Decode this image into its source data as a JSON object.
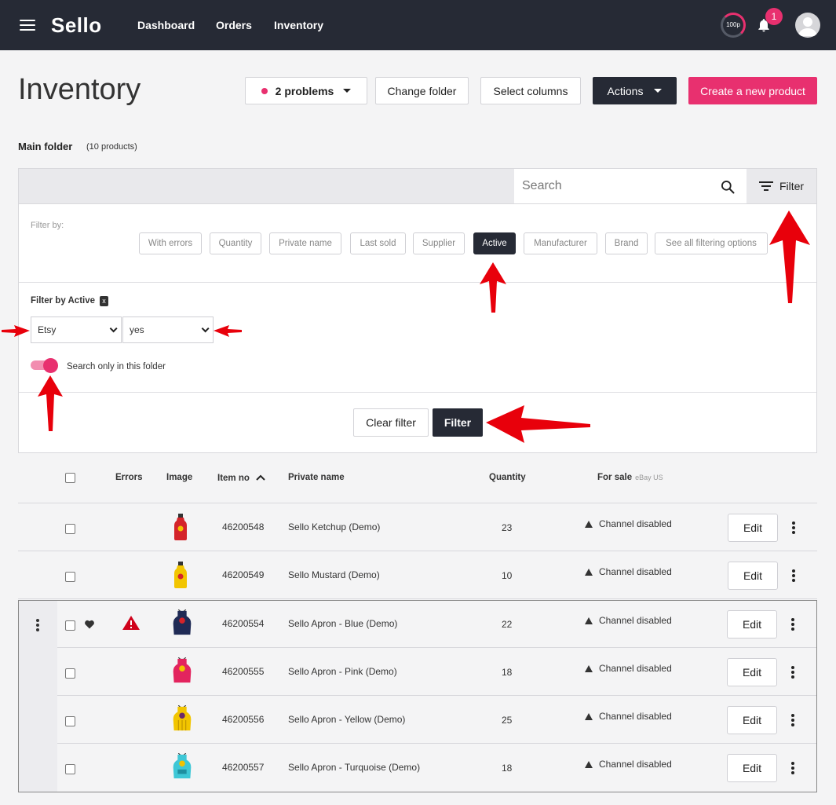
{
  "app": {
    "logo": "Sello",
    "nav": [
      "Dashboard",
      "Orders",
      "Inventory"
    ],
    "usage_label": "100p",
    "notification_count": "1"
  },
  "header": {
    "title": "Inventory",
    "problems_label": "2 problems",
    "change_folder_label": "Change folder",
    "select_columns_label": "Select columns",
    "actions_label": "Actions",
    "create_label": "Create a new product"
  },
  "folder": {
    "name": "Main folder",
    "count": "(10 products)"
  },
  "search": {
    "placeholder": "Search",
    "filter_label": "Filter"
  },
  "filter": {
    "filter_by_label": "Filter by:",
    "chips": [
      "With errors",
      "Quantity",
      "Private name",
      "Last sold",
      "Supplier",
      "Active",
      "Manufacturer",
      "Brand",
      "See all filtering options"
    ],
    "active_chip": "Active",
    "active_title": "Filter by Active",
    "remove_label": "x",
    "channel_value": "Etsy",
    "state_value": "yes",
    "toggle_label": "Search only in this folder",
    "toggle_on": true,
    "clear_label": "Clear filter",
    "apply_label": "Filter"
  },
  "table": {
    "headers": {
      "errors": "Errors",
      "image": "Image",
      "item_no": "Item no",
      "private_name": "Private name",
      "quantity": "Quantity",
      "for_sale": "For sale",
      "for_sale_sub": "eBay US"
    },
    "edit_label": "Edit",
    "rows": [
      {
        "item_no": "46200548",
        "name": "Sello Ketchup (Demo)",
        "quantity": "23",
        "status": "Channel disabled",
        "image": "ketchup-bottle"
      },
      {
        "item_no": "46200549",
        "name": "Sello Mustard (Demo)",
        "quantity": "10",
        "status": "Channel disabled",
        "image": "mustard-bottle"
      },
      {
        "item_no": "46200554",
        "name": "Sello Apron - Blue (Demo)",
        "quantity": "22",
        "status": "Channel disabled",
        "image": "apron-blue"
      },
      {
        "item_no": "46200555",
        "name": "Sello Apron - Pink (Demo)",
        "quantity": "18",
        "status": "Channel disabled",
        "image": "apron-pink"
      },
      {
        "item_no": "46200556",
        "name": "Sello Apron - Yellow (Demo)",
        "quantity": "25",
        "status": "Channel disabled",
        "image": "apron-yellow"
      },
      {
        "item_no": "46200557",
        "name": "Sello Apron - Turquoise (Demo)",
        "quantity": "18",
        "status": "Channel disabled",
        "image": "apron-turquoise"
      }
    ]
  },
  "colors": {
    "topbar": "#262a35",
    "accent": "#e8306f",
    "annotation_arrow": "#e8000b"
  }
}
